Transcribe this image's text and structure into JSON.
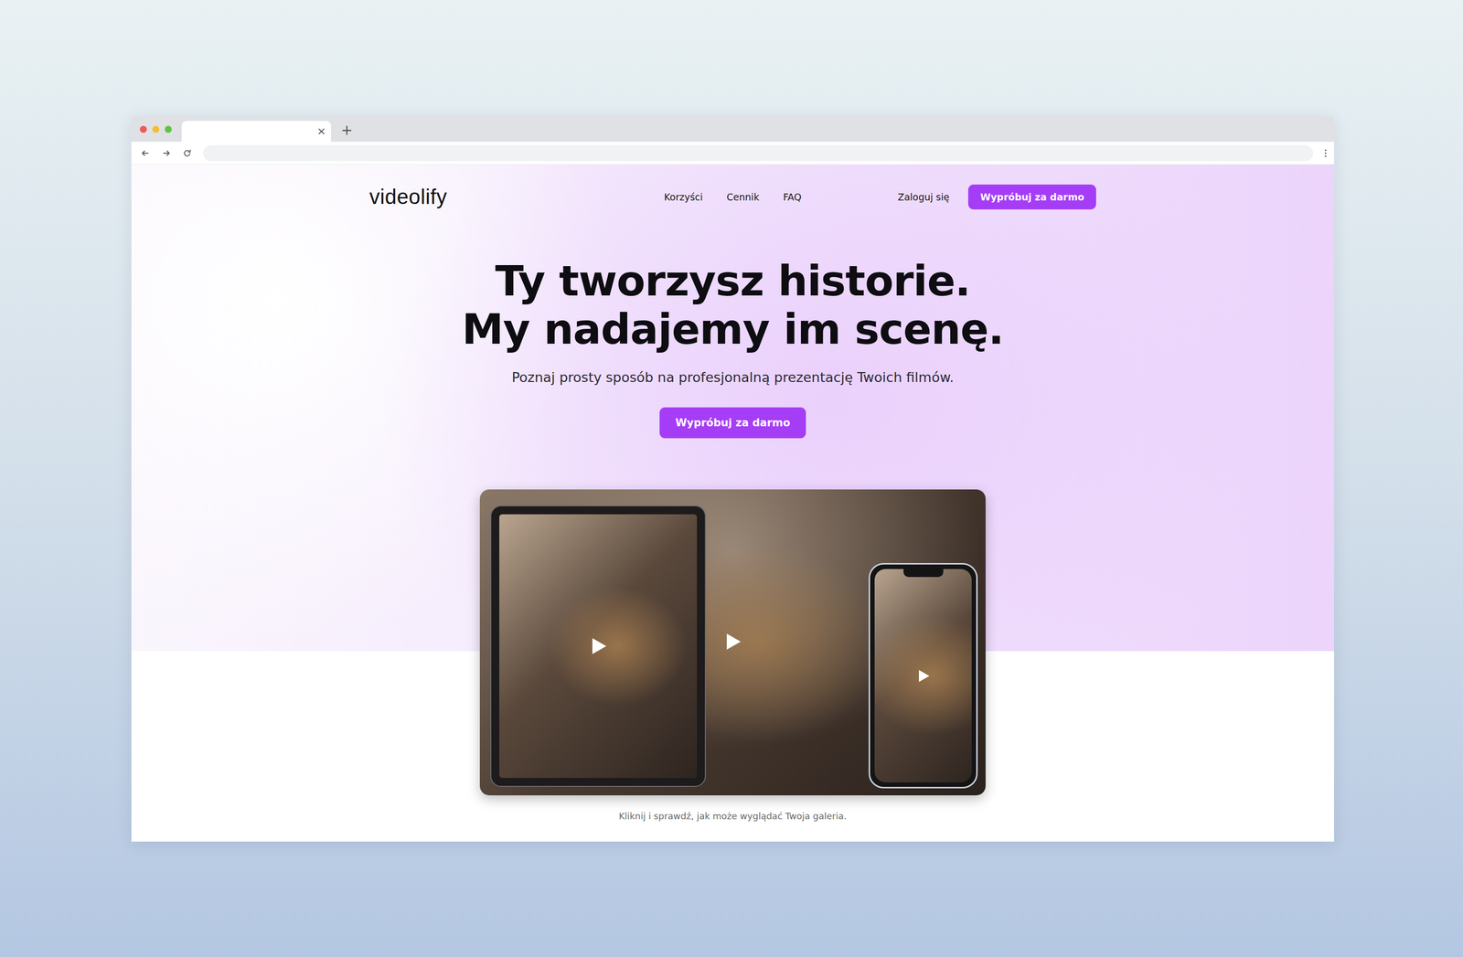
{
  "browser": {
    "tabs": [
      {
        "selected": true,
        "close": "×"
      }
    ],
    "new_tab": "+"
  },
  "nav": {
    "logo": "videolify",
    "links": [
      {
        "label": "Korzyści"
      },
      {
        "label": "Cennik"
      },
      {
        "label": "FAQ"
      }
    ],
    "login": "Zaloguj się",
    "cta": "Wypróbuj za darmo"
  },
  "hero": {
    "title_lines": [
      "Ty tworzysz historie.",
      "My nadajemy im scenę."
    ],
    "subtitle": "Poznaj prosty sposób na profesjonalną prezentację Twoich filmów.",
    "cta": "Wypróbuj za darmo"
  },
  "gallery": {
    "caption": "Kliknij i sprawdź, jak może wyglądać Twoja galeria."
  }
}
